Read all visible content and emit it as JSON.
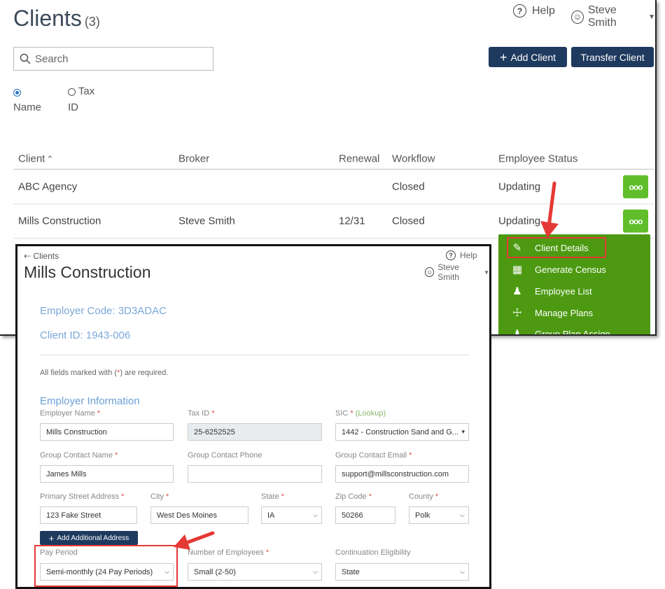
{
  "clients_page": {
    "title": "Clients",
    "count": "(3)",
    "help": "Help",
    "user": "Steve Smith",
    "search_placeholder": "Search",
    "add_client": "Add Client",
    "transfer_client": "Transfer Client",
    "radio_name": "Name",
    "radio_tax_1": "Tax",
    "radio_tax_2": "ID",
    "columns": [
      "Client",
      "Broker",
      "Renewal",
      "Workflow",
      "Employee Status"
    ],
    "rows": [
      {
        "client": "ABC Agency",
        "broker": "",
        "renewal": "",
        "workflow": "Closed",
        "status": "Updating"
      },
      {
        "client": "Mills Construction",
        "broker": "Steve Smith",
        "renewal": "12/31",
        "workflow": "Closed",
        "status": "Updating"
      }
    ],
    "menu": [
      "Client Details",
      "Generate Census",
      "Employee List",
      "Manage Plans",
      "Group Plan Assign"
    ]
  },
  "details_page": {
    "breadcrumb": "Clients",
    "title": "Mills Construction",
    "help": "Help",
    "user": "Steve Smith",
    "employer_code": "Employer Code: 3D3ADAC",
    "client_id": "Client ID: 1943-006",
    "note_pre": "All fields marked with (",
    "note_star": "*",
    "note_post": ") are required.",
    "section": "Employer Information",
    "lookup": "(Lookup)",
    "labels": {
      "employer_name": "Employer Name",
      "tax_id": "Tax ID",
      "sic": "SIC",
      "group_contact_name": "Group Contact Name",
      "group_contact_phone": "Group Contact Phone",
      "group_contact_email": "Group Contact Email",
      "street": "Primary Street Address",
      "city": "City",
      "state": "State",
      "zip": "Zip Code",
      "county": "County",
      "pay_period": "Pay Period",
      "num_employees": "Number of Employees",
      "continuation": "Continuation Eligibility"
    },
    "values": {
      "employer_name": "Mills Construction",
      "tax_id": "25-6252525",
      "sic": "1442 - Construction Sand and G...",
      "group_contact_name": "James Mills",
      "group_contact_phone": "",
      "group_contact_email": "support@millsconstruction.com",
      "street": "123 Fake Street",
      "city": "West Des Moines",
      "state": "IA",
      "zip": "50266",
      "county": "Polk",
      "pay_period": "Semi-monthly (24 Pay Periods)",
      "num_employees": "Small (2-50)",
      "continuation": "State"
    },
    "add_address": "Add Additional Address",
    "star": "*"
  }
}
